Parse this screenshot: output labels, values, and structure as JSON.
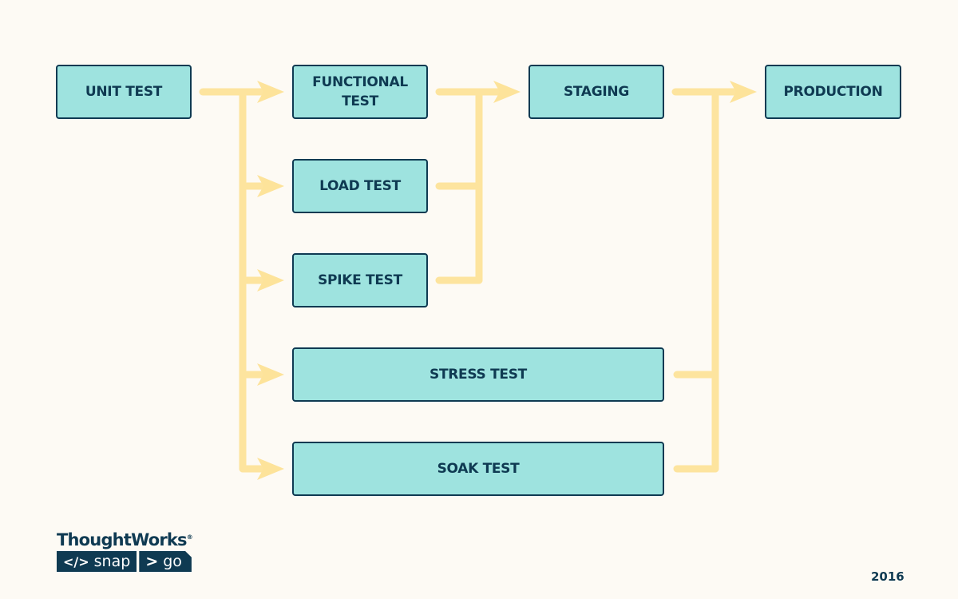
{
  "colors": {
    "box_fill": "#9ee3df",
    "box_border": "#0f3a52",
    "connector": "#fde39a",
    "text": "#0f3a52",
    "background": "#fdfaf4"
  },
  "nodes": {
    "unit_test": "UNIT TEST",
    "functional_test_line1": "FUNCTIONAL",
    "functional_test_line2": "TEST",
    "load_test": "LOAD TEST",
    "spike_test": "SPIKE TEST",
    "stress_test": "STRESS TEST",
    "soak_test": "SOAK TEST",
    "staging": "STAGING",
    "production": "PRODUCTION"
  },
  "edges": [
    {
      "from": "UNIT TEST",
      "to": [
        "FUNCTIONAL TEST",
        "LOAD TEST",
        "SPIKE TEST",
        "STRESS TEST",
        "SOAK TEST"
      ]
    },
    {
      "from": [
        "FUNCTIONAL TEST",
        "LOAD TEST",
        "SPIKE TEST"
      ],
      "to": "STAGING"
    },
    {
      "from": [
        "STAGING",
        "STRESS TEST",
        "SOAK TEST"
      ],
      "to": "PRODUCTION"
    }
  ],
  "footer": {
    "brand": "ThoughtWorks",
    "registered": "®",
    "badge_snap_icon": "</>",
    "badge_snap": "snap",
    "badge_go_icon": ">",
    "badge_go": "go",
    "year": "2016"
  }
}
